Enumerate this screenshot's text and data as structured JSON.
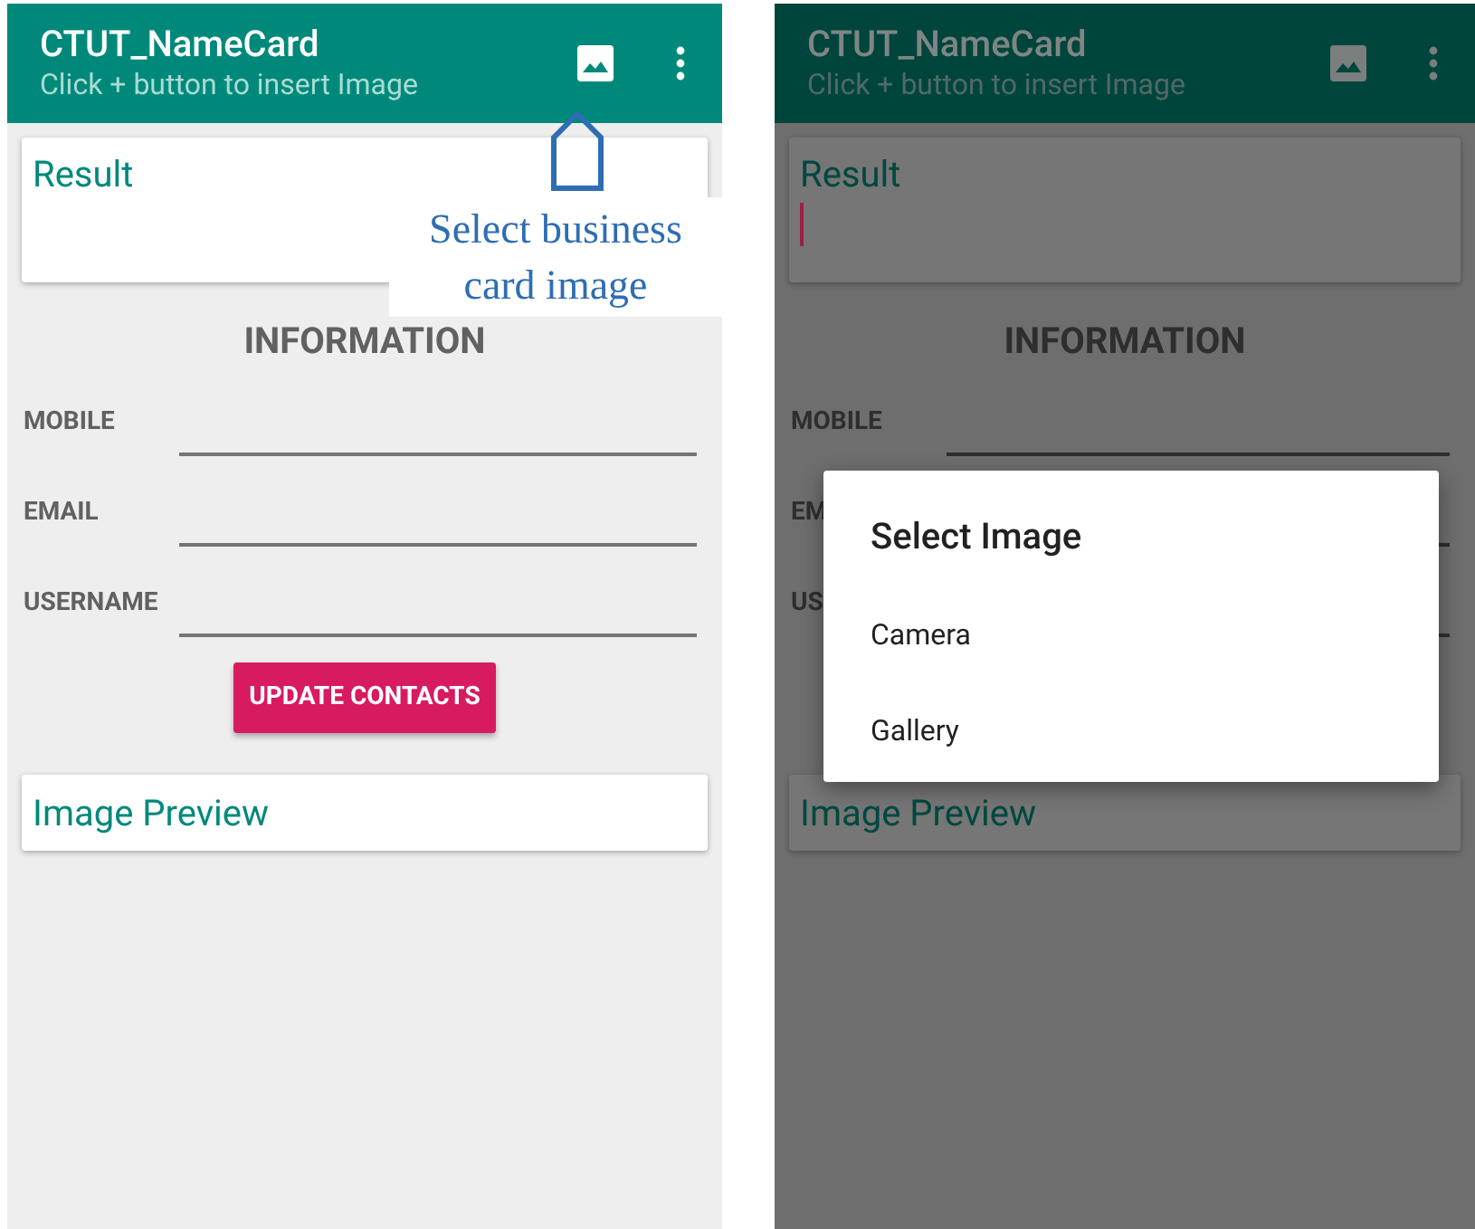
{
  "left_screen": {
    "app_bar": {
      "title": "CTUT_NameCard",
      "subtitle": "Click + button to insert Image"
    },
    "result_card": {
      "label": "Result"
    },
    "section_title": "INFORMATION",
    "fields": [
      {
        "label": "MOBILE"
      },
      {
        "label": "EMAIL"
      },
      {
        "label": "USERNAME"
      }
    ],
    "update_button": "UPDATE CONTACTS",
    "preview_card": {
      "label": "Image Preview"
    },
    "callout": "Select business card image"
  },
  "right_screen": {
    "app_bar": {
      "title": "CTUT_NameCard",
      "subtitle": "Click + button to insert Image"
    },
    "result_card": {
      "label": "Result"
    },
    "section_title": "INFORMATION",
    "fields": [
      {
        "label": "MOBILE"
      },
      {
        "label": "EM"
      },
      {
        "label": "US"
      }
    ],
    "preview_card": {
      "label": "Image Preview"
    },
    "dialog": {
      "title": "Select Image",
      "options": [
        "Camera",
        "Gallery"
      ]
    }
  }
}
